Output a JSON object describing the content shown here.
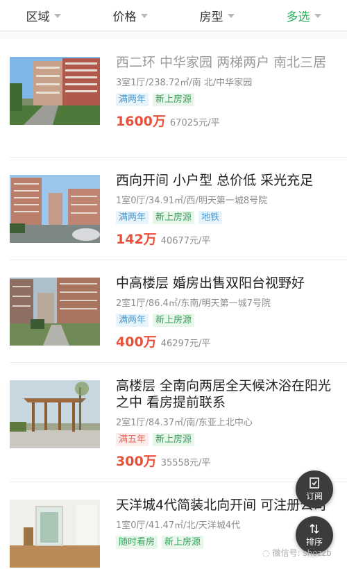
{
  "filters": [
    {
      "label": "区域",
      "active": false
    },
    {
      "label": "价格",
      "active": false
    },
    {
      "label": "房型",
      "active": false
    },
    {
      "label": "多选",
      "active": true
    }
  ],
  "listings": [
    {
      "title": "西二环  中华家园  两梯两户 南北三居",
      "meta": "3室1厅/238.72㎡/南 北/中华家园",
      "tags": [
        {
          "text": "满两年",
          "style": "blue"
        },
        {
          "text": "新上房源",
          "style": "green"
        }
      ],
      "price": "1600",
      "price_unit": "万",
      "unit_price": "67025元/平"
    },
    {
      "title": "西向开间 小户型 总价低 采光充足",
      "meta": "1室0厅/34.91㎡/西/明天第一城8号院",
      "tags": [
        {
          "text": "满两年",
          "style": "blue"
        },
        {
          "text": "新上房源",
          "style": "green"
        },
        {
          "text": "地铁",
          "style": "blue"
        }
      ],
      "price": "142",
      "price_unit": "万",
      "unit_price": "40677元/平"
    },
    {
      "title": "中高楼层 婚房出售双阳台视野好",
      "meta": "2室1厅/86.4㎡/东南/明天第一城7号院",
      "tags": [
        {
          "text": "满两年",
          "style": "blue"
        },
        {
          "text": "新上房源",
          "style": "green"
        }
      ],
      "price": "400",
      "price_unit": "万",
      "unit_price": "46297元/平"
    },
    {
      "title": "高楼层 全南向两居全天候沐浴在阳光之中 看房提前联系",
      "meta": "2室1厅/84.37㎡/南/东亚上北中心",
      "tags": [
        {
          "text": "满五年",
          "style": "red"
        },
        {
          "text": "新上房源",
          "style": "green"
        }
      ],
      "price": "300",
      "price_unit": "万",
      "unit_price": "35558元/平"
    },
    {
      "title": "天洋城4代简装北向开间 可注册公司",
      "meta": "1室0厅/41.47㎡/北/天洋城4代",
      "tags": [
        {
          "text": "随时看房",
          "style": "green"
        },
        {
          "text": "新上房源",
          "style": "green"
        }
      ],
      "price": "",
      "price_unit": "",
      "unit_price": ""
    }
  ],
  "fab": {
    "subscribe_label": "订阅",
    "sort_label": "排序"
  },
  "watermark": "微信号: shozzb",
  "colors": {
    "accent_green": "#27b35a",
    "price_red": "#e8503a"
  }
}
